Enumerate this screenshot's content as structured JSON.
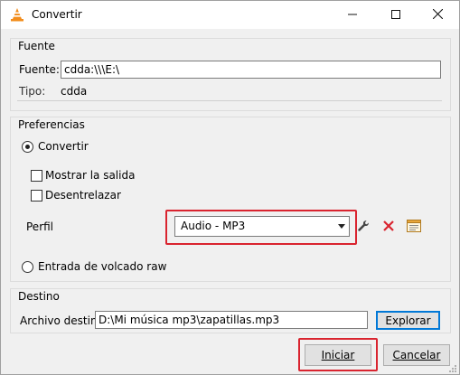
{
  "window": {
    "title": "Convertir",
    "icon": "vlc-cone-icon",
    "controls": [
      "minimize",
      "maximize",
      "close"
    ]
  },
  "fuente": {
    "group_title": "Fuente",
    "source_label": "Fuente:",
    "source_value": "cdda:\\\\\\E:\\",
    "type_label": "Tipo:",
    "type_value": "cdda"
  },
  "preferencias": {
    "group_title": "Preferencias",
    "convert_label": "Convertir",
    "convert_selected": true,
    "show_output_label": "Mostrar la salida",
    "show_output_checked": false,
    "deinterlace_label": "Desentrelazar",
    "deinterlace_checked": false,
    "profile_label": "Perfil",
    "profile_value": "Audio - MP3",
    "raw_dump_label": "Entrada de volcado raw",
    "raw_dump_selected": false
  },
  "destino": {
    "group_title": "Destino",
    "file_label": "Archivo destino:",
    "file_value": "D:\\Mi música mp3\\zapatillas.mp3",
    "browse_label": "Explorar"
  },
  "footer": {
    "start_label": "Iniciar",
    "cancel_label": "Cancelar"
  },
  "colors": {
    "highlight": "#d9242f",
    "accent": "#0078d7",
    "delete_icon": "#d9242f"
  }
}
